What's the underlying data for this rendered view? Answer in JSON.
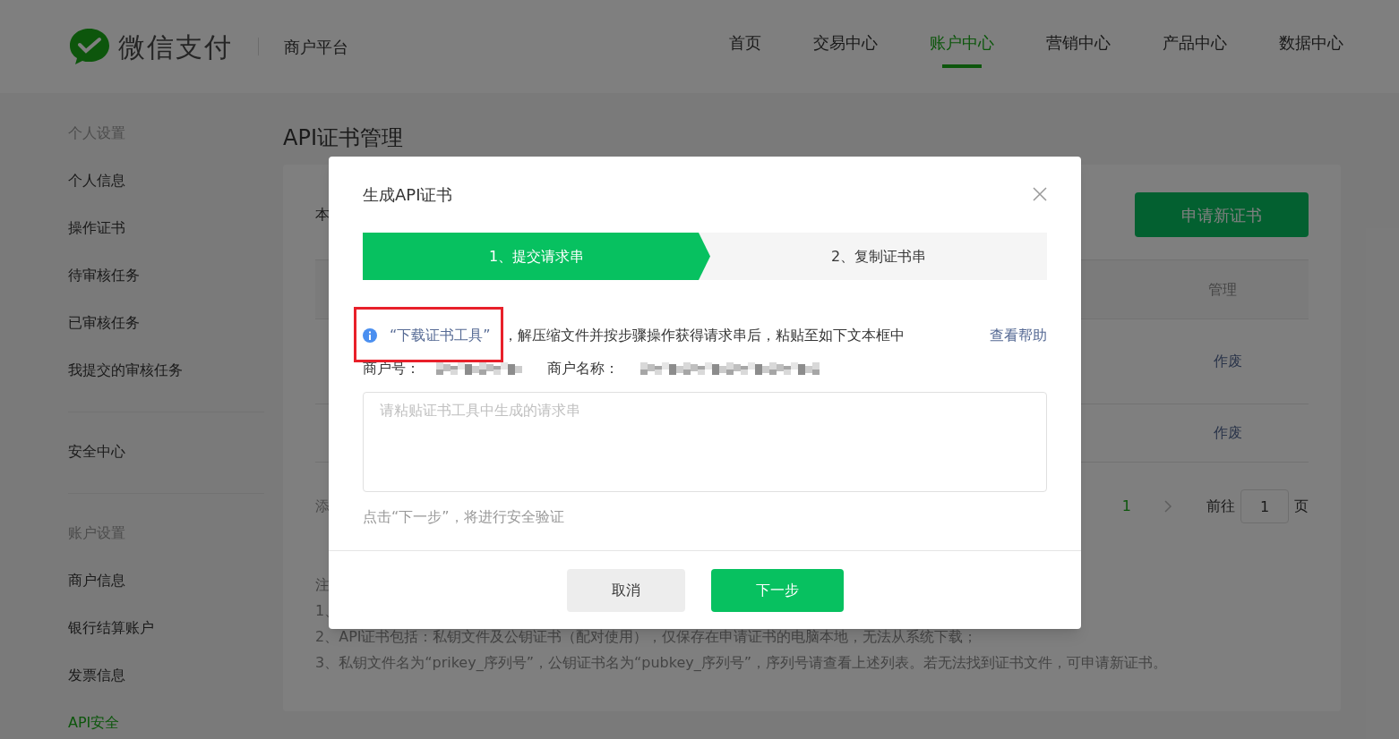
{
  "header": {
    "brand": "微信支付",
    "platform": "商户平台",
    "nav": [
      {
        "label": "首页",
        "selected": false
      },
      {
        "label": "交易中心",
        "selected": false
      },
      {
        "label": "账户中心",
        "selected": true
      },
      {
        "label": "营销中心",
        "selected": false
      },
      {
        "label": "产品中心",
        "selected": false
      },
      {
        "label": "数据中心",
        "selected": false
      }
    ]
  },
  "sidebar": {
    "groups": [
      {
        "title": "个人设置",
        "items": [
          {
            "label": "个人信息",
            "selected": false
          },
          {
            "label": "操作证书",
            "selected": false
          },
          {
            "label": "待审核任务",
            "selected": false
          },
          {
            "label": "已审核任务",
            "selected": false
          },
          {
            "label": "我提交的审核任务",
            "selected": false
          }
        ]
      },
      {
        "items": [
          {
            "label": "安全中心",
            "selected": false
          }
        ]
      },
      {
        "title": "账户设置",
        "items": [
          {
            "label": "商户信息",
            "selected": false
          },
          {
            "label": "银行结算账户",
            "selected": false
          },
          {
            "label": "发票信息",
            "selected": false
          },
          {
            "label": "API安全",
            "selected": true
          }
        ]
      }
    ]
  },
  "page": {
    "title": "API证书管理",
    "intro_fragment": "本",
    "apply_button": "申请新证书",
    "table": {
      "manage_header": "管理",
      "rows": [
        {
          "action": "作废"
        },
        {
          "action": "作废"
        }
      ]
    },
    "add_fragment": "添",
    "pagination": {
      "current_page": "1",
      "goto_label": "前往",
      "goto_value": "1",
      "page_suffix": "页"
    },
    "notes": [
      "注",
      "1、",
      "2、API证书包括：私钥文件及公钥证书（配对使用），仅保存在申请证书的电脑本地，无法从系统下载；",
      "3、私钥文件名为“prikey_序列号”，公钥证书名为“pubkey_序列号”，序列号请查看上述列表。若无法找到证书文件，可申请新证书。"
    ]
  },
  "dialog": {
    "title": "生成API证书",
    "steps": [
      {
        "label": "1、提交请求串",
        "selected": true
      },
      {
        "label": "2、复制证书串",
        "selected": false
      }
    ],
    "download_link": "“下载证书工具”",
    "instruction": "，解压缩文件并按步骤操作获得请求串后，粘贴至如下文本框中",
    "help_link": "查看帮助",
    "merchant_id_label": "商户号：",
    "merchant_name_label": "商户名称：",
    "request_field": {
      "placeholder": "请粘贴证书工具中生成的请求串"
    },
    "hint": "点击“下一步”，将进行安全验证",
    "buttons": [
      {
        "label": "取消",
        "kind": "secondary"
      },
      {
        "label": "下一步",
        "kind": "primary"
      }
    ]
  }
}
